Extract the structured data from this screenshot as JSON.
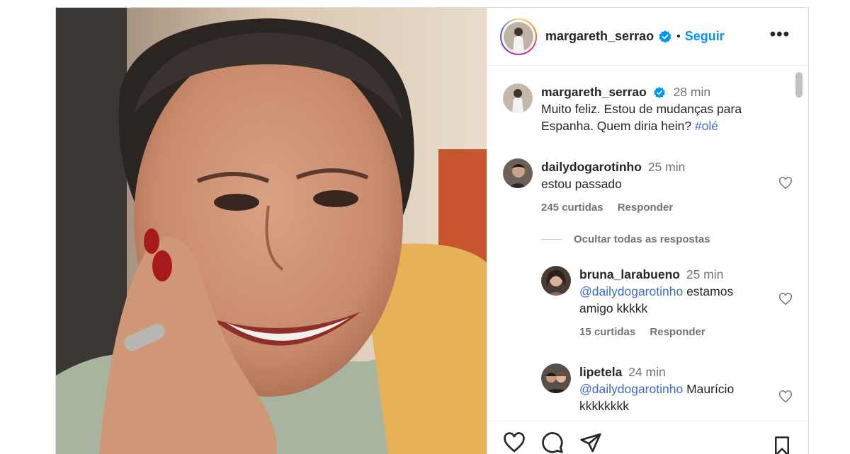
{
  "header": {
    "username": "margareth_serrao",
    "separator": "•",
    "follow_label": "Seguir",
    "more_label": "•••"
  },
  "caption": {
    "username": "margareth_serrao",
    "time": "28 min",
    "text": "Muito feliz. Estou de mudanças para Espanha. Quem diria hein?",
    "hashtag": "#olé"
  },
  "comments": [
    {
      "username": "dailydogarotinho",
      "time": "25 min",
      "text": "estou passado",
      "likes": "245 curtidas",
      "reply_label": "Responder"
    }
  ],
  "hide_replies_label": "Ocultar todas as respostas",
  "replies": [
    {
      "username": "bruna_larabueno",
      "time": "25 min",
      "mention": "@dailydogarotinho",
      "text_line1": "estamos",
      "text_line2": "amigo kkkkk",
      "likes": "15 curtidas",
      "reply_label": "Responder"
    },
    {
      "username": "lipetela",
      "time": "24 min",
      "mention": "@dailydogarotinho",
      "text_line1": "Maurício",
      "text_line2": "kkkkkkkk"
    }
  ],
  "icons": {
    "verified": "verified-badge-icon",
    "like": "heart-icon",
    "comment": "comment-bubble-icon",
    "share": "paper-plane-icon",
    "save": "bookmark-icon",
    "more": "more-options-icon"
  },
  "colors": {
    "follow": "#0095f6",
    "verified": "#0095f6",
    "secondary_text": "#737373",
    "border": "#dbdbdb"
  }
}
